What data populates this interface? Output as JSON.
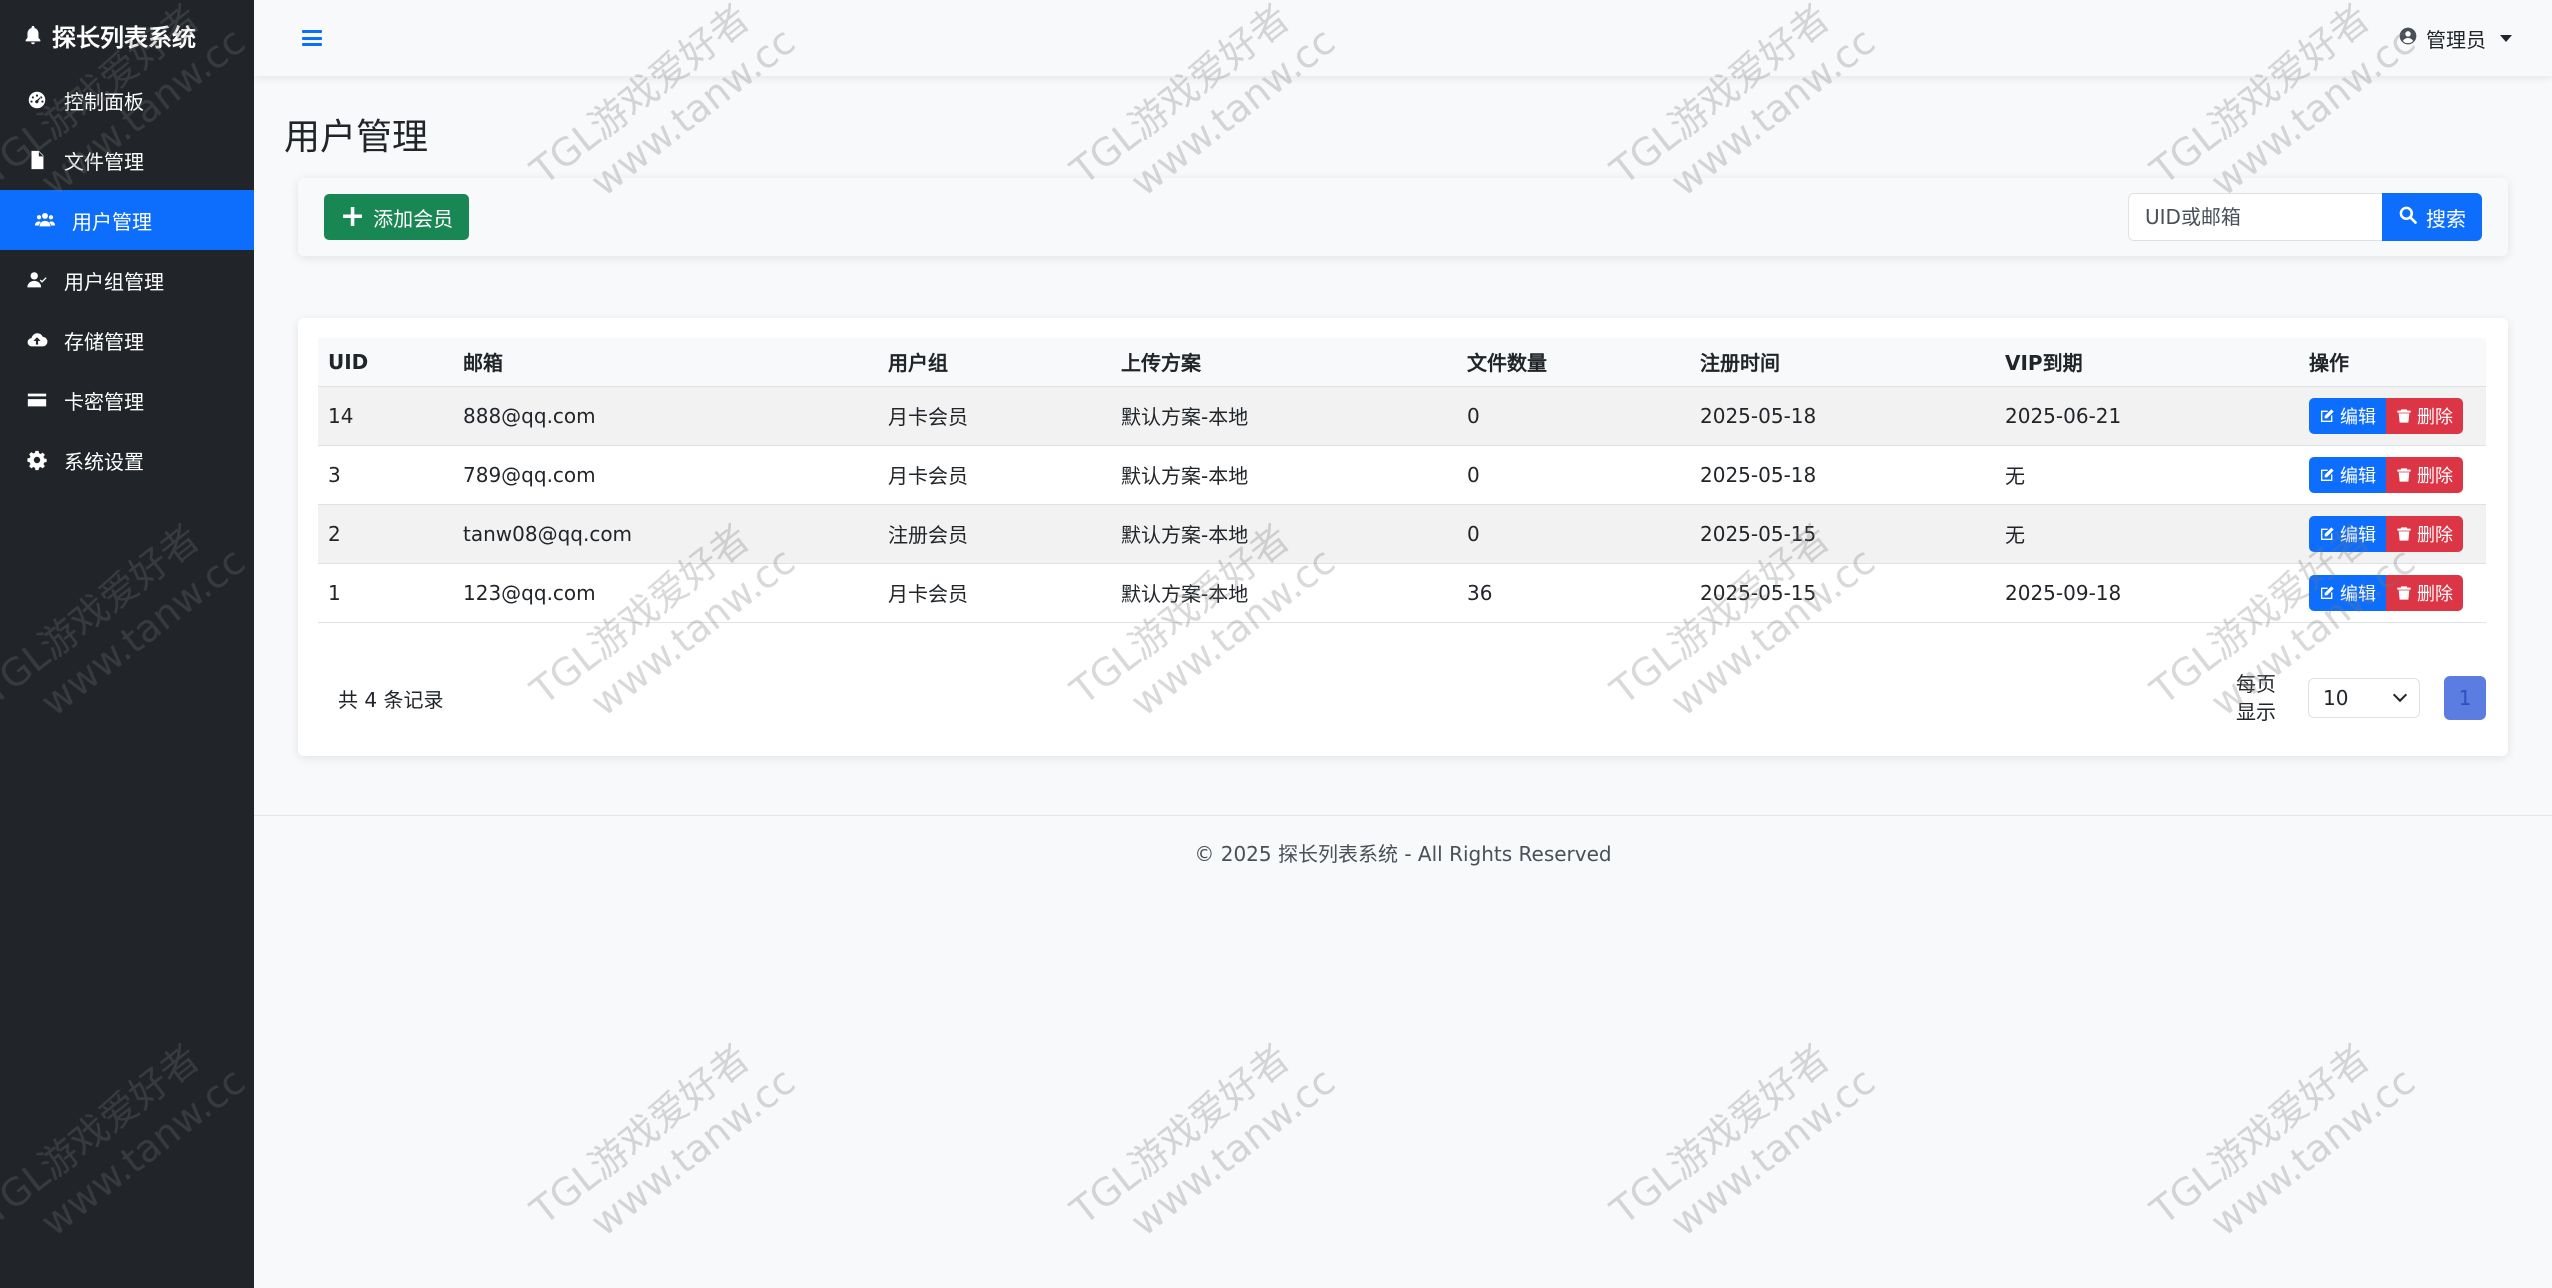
{
  "brand": {
    "title": "探长列表系统",
    "icon": "bell-icon"
  },
  "sidebar": {
    "items": [
      {
        "label": "控制面板",
        "icon": "dashboard-icon",
        "active": false
      },
      {
        "label": "文件管理",
        "icon": "file-icon",
        "active": false
      },
      {
        "label": "用户管理",
        "icon": "users-icon",
        "active": true
      },
      {
        "label": "用户组管理",
        "icon": "user-group-icon",
        "active": false
      },
      {
        "label": "存储管理",
        "icon": "cloud-upload-icon",
        "active": false
      },
      {
        "label": "卡密管理",
        "icon": "card-icon",
        "active": false
      },
      {
        "label": "系统设置",
        "icon": "gear-icon",
        "active": false
      }
    ]
  },
  "header": {
    "menu_icon": "hamburger-icon",
    "admin_label": "管理员"
  },
  "page": {
    "title": "用户管理"
  },
  "toolbar": {
    "add_label": "添加会员",
    "search_placeholder": "UID或邮箱",
    "search_label": "搜索"
  },
  "table": {
    "columns": [
      "UID",
      "邮箱",
      "用户组",
      "上传方案",
      "文件数量",
      "注册时间",
      "VIP到期",
      "操作"
    ],
    "rows": [
      {
        "uid": "14",
        "email": "888@qq.com",
        "group": "月卡会员",
        "plan": "默认方案-本地",
        "files": "0",
        "registered": "2025-05-18",
        "vip": "2025-06-21"
      },
      {
        "uid": "3",
        "email": "789@qq.com",
        "group": "月卡会员",
        "plan": "默认方案-本地",
        "files": "0",
        "registered": "2025-05-18",
        "vip": "无"
      },
      {
        "uid": "2",
        "email": "tanw08@qq.com",
        "group": "注册会员",
        "plan": "默认方案-本地",
        "files": "0",
        "registered": "2025-05-15",
        "vip": "无"
      },
      {
        "uid": "1",
        "email": "123@qq.com",
        "group": "月卡会员",
        "plan": "默认方案-本地",
        "files": "36",
        "registered": "2025-05-15",
        "vip": "2025-09-18"
      }
    ],
    "edit_label": "编辑",
    "delete_label": "删除"
  },
  "pagination": {
    "total_text": "共 4 条记录",
    "per_page_label": "每页显示",
    "per_page_value": "10",
    "current_page": "1"
  },
  "footer": {
    "text": "© 2025 探长列表系统 - All Rights Reserved"
  },
  "watermark": {
    "line1": "TGL游戏爱好者",
    "line2": "www.tanw.cc"
  },
  "colors": {
    "sidebar": "#212529",
    "primary": "#0d6efd",
    "success": "#198754",
    "danger": "#dc3545"
  }
}
